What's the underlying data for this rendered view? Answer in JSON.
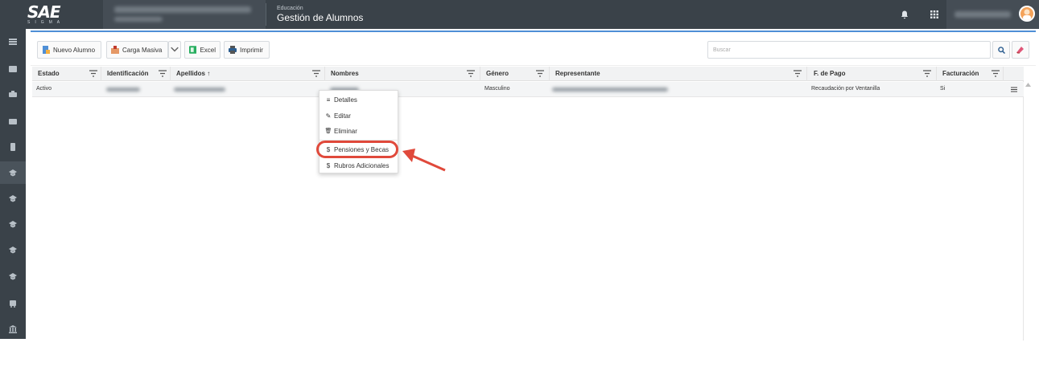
{
  "header": {
    "logo": "SAE",
    "logo_sub": "SIGMA",
    "module": "Educación",
    "title": "Gestión de Alumnos"
  },
  "toolbar": {
    "new_label": "Nuevo Alumno",
    "bulk_label": "Carga Masiva",
    "excel_label": "Excel",
    "print_label": "Imprimir",
    "search_placeholder": "Buscar"
  },
  "table": {
    "columns": [
      "Estado",
      "Identificación",
      "Apellidos ↑",
      "Nombres",
      "Género",
      "Representante",
      "F. de Pago",
      "Facturación"
    ],
    "row": {
      "estado": "Activo",
      "genero": "Masculino",
      "f_pago": "Recaudación por Ventanilla",
      "facturacion": "Si"
    }
  },
  "context_menu": {
    "items": [
      {
        "icon": "≡",
        "label": "Detalles"
      },
      {
        "icon": "✎",
        "label": "Editar"
      },
      {
        "icon": "🗑",
        "label": "Eliminar"
      },
      {
        "icon": "$",
        "label": "Pensiones y Becas"
      },
      {
        "icon": "$",
        "label": "Rubros Adicionales"
      }
    ]
  },
  "colors": {
    "topbar": "#3a4249",
    "accent": "#4f8fd6",
    "highlight": "#e0493b"
  }
}
